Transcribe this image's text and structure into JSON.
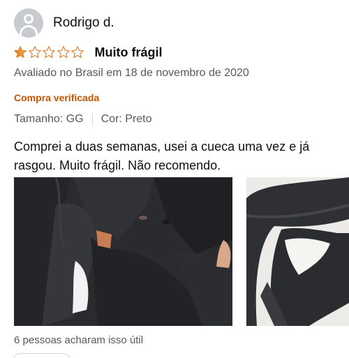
{
  "reviewer": {
    "name": "Rodrigo d."
  },
  "rating": {
    "value": 1,
    "max": 5,
    "filled_color": "#de7921",
    "empty_color": "#de7921"
  },
  "review": {
    "title": "Muito frágil",
    "date": "Avaliado no Brasil em 18 de novembro de 2020",
    "verified": "Compra verificada",
    "size": "Tamanho: GG",
    "color": "Cor: Preto",
    "body": "Comprei a duas semanas, usei a cueca uma vez e já rasgou. Muito frágil. Não recomendo."
  },
  "photos": [
    {
      "icon": "review-photo-1"
    },
    {
      "icon": "review-photo-2"
    }
  ],
  "helpful": {
    "text": "6 pessoas acharam isso útil"
  },
  "colors": {
    "link_orange": "#c45500",
    "secondary_text": "#565959",
    "star": "#de7921"
  }
}
